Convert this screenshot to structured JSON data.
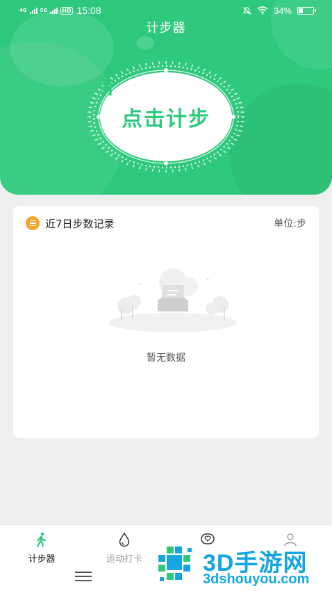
{
  "status_bar": {
    "network_left": "4G",
    "network_right": "5G",
    "hd_label": "HD",
    "time": "15:08",
    "battery_percent": "34%",
    "battery_level": 0.34
  },
  "header": {
    "title": "计步器",
    "step_button_label": "点击计步"
  },
  "records_card": {
    "title": "近7日步数记录",
    "unit_label": "单位:步",
    "empty_text": "暂无数据"
  },
  "bottom_nav": {
    "items": [
      {
        "label": "计步器",
        "icon": "walking-icon",
        "active": true
      },
      {
        "label": "运动打卡",
        "icon": "water-drop-icon",
        "active": false
      },
      {
        "label": "",
        "icon": "heart-chat-icon",
        "active": false
      },
      {
        "label": "",
        "icon": "user-icon",
        "active": false
      }
    ]
  },
  "watermark": {
    "brand": "3D手游网",
    "url": "3dshouyou.com"
  },
  "colors": {
    "primary": "#2ec97c",
    "accent_orange": "#f5a531",
    "watermark_blue": "#15a6e0"
  }
}
